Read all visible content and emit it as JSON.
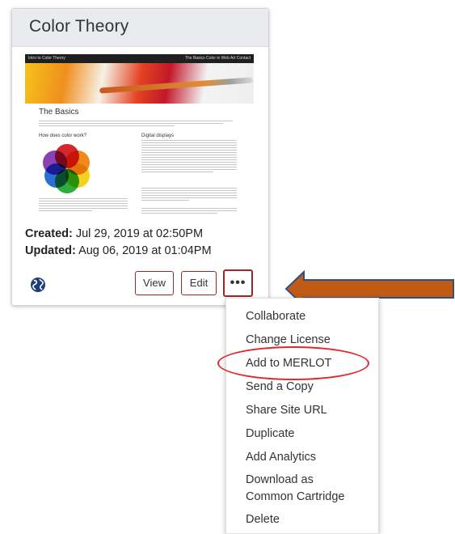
{
  "card": {
    "title": "Color Theory",
    "thumbnail": {
      "nav_title": "Intro to Color Theory",
      "nav_links": "The Basics   Color in Web Art   Contact",
      "heading": "The Basics",
      "subheading_left": "How does color work?",
      "subheading_right": "Digital displays"
    },
    "created_label": "Created:",
    "created_value": " Jul 29, 2019 at 02:50PM",
    "updated_label": "Updated:",
    "updated_value": " Aug 06, 2019 at 01:04PM",
    "globe_icon": "globe-icon",
    "view_label": "View",
    "edit_label": "Edit",
    "more_label": "•••"
  },
  "menu": {
    "items": [
      "Collaborate",
      "Change License",
      "Add to MERLOT",
      "Send a Copy",
      "Share Site URL",
      "Duplicate",
      "Add Analytics",
      "Download as\nCommon Cartridge",
      "Delete"
    ]
  },
  "colors": {
    "button_border": "#a0262a",
    "arrow_fill": "#c05a14",
    "arrow_stroke": "#2f4f86",
    "highlight": "#e0272e",
    "globe": "#1d3f7a"
  }
}
